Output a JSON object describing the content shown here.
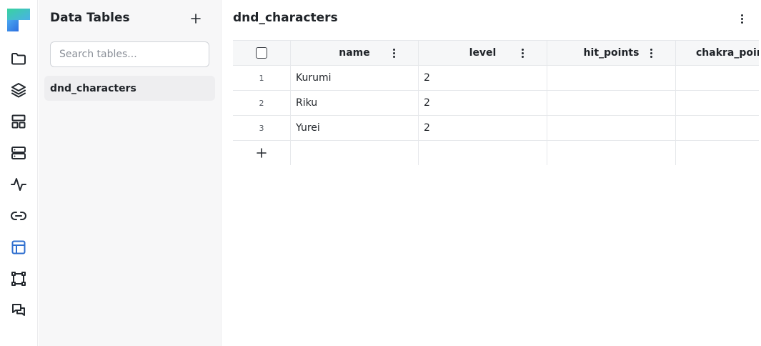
{
  "sidebar": {
    "title": "Data Tables",
    "search_placeholder": "Search tables...",
    "tables": [
      "dnd_characters"
    ]
  },
  "rail": {
    "icons": [
      "folder-icon",
      "layers-icon",
      "layout-icon",
      "server-icon",
      "activity-icon",
      "link-icon",
      "table-icon",
      "frame-icon",
      "messages-icon"
    ],
    "active": "table-icon",
    "accent": "#2f6fcf"
  },
  "main": {
    "title": "dnd_characters",
    "columns": [
      "name",
      "level",
      "hit_points",
      "chakra_points"
    ],
    "rows": [
      {
        "index": "1",
        "name": "Kurumi",
        "level": "2",
        "hit_points": "",
        "chakra_points": ""
      },
      {
        "index": "2",
        "name": "Riku",
        "level": "2",
        "hit_points": "",
        "chakra_points": ""
      },
      {
        "index": "3",
        "name": "Yurei",
        "level": "2",
        "hit_points": "",
        "chakra_points": ""
      }
    ],
    "add_row_icon": "plus-icon"
  }
}
